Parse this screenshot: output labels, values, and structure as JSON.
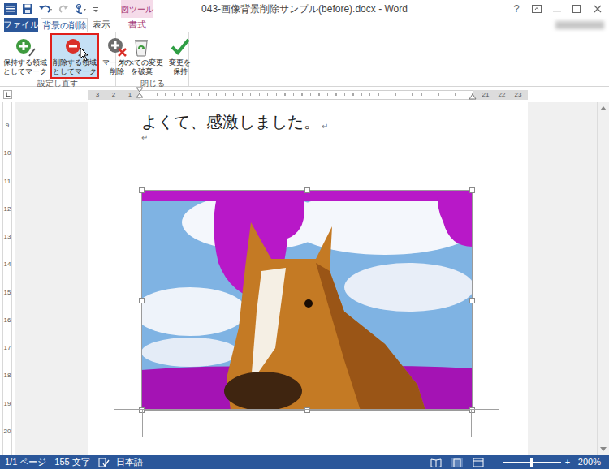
{
  "window": {
    "title": "043-画像背景削除サンプル(before).docx - Word",
    "help": "?"
  },
  "context_tab_group": "図ツール",
  "tabs": [
    {
      "label": "ファイル",
      "selected": false,
      "kind": "file"
    },
    {
      "label": "背景の削除",
      "selected": true,
      "kind": "context"
    },
    {
      "label": "表示",
      "selected": false,
      "kind": "tab"
    },
    {
      "label": "書式",
      "selected": false,
      "kind": "context"
    }
  ],
  "ribbon": {
    "groups": [
      {
        "label": "設定し直す",
        "buttons": [
          {
            "lines": [
              "保持する領域",
              "としてマーク"
            ],
            "highlighted": false
          },
          {
            "lines": [
              "削除する領域",
              "としてマーク"
            ],
            "highlighted": true
          },
          {
            "lines": [
              "マークの",
              "削除"
            ],
            "highlighted": false
          }
        ]
      },
      {
        "label": "閉じる",
        "buttons": [
          {
            "lines": [
              "すべての変更",
              "を破棄"
            ],
            "highlighted": false
          },
          {
            "lines": [
              "変更を",
              "保持"
            ],
            "highlighted": false
          }
        ]
      }
    ]
  },
  "ruler": {
    "left_numbers": [
      "3",
      "2",
      "1"
    ],
    "right_numbers": [
      "21",
      "22",
      "23"
    ]
  },
  "vertical_ruler": [
    "9",
    "10",
    "11",
    "12",
    "13",
    "14",
    "15",
    "16",
    "17",
    "18",
    "19",
    "20"
  ],
  "document": {
    "lines": [
      {
        "text": "よくて、感激しました。",
        "mark": "↵"
      },
      {
        "mark": "↵"
      }
    ],
    "picture": {
      "selected": true
    }
  },
  "status_bar": {
    "page": "1/1 ページ",
    "words": "155 文字",
    "language": "日本語",
    "zoom_out": "-",
    "zoom_in": "+",
    "zoom": "200%",
    "zoom_level": 0.5
  }
}
